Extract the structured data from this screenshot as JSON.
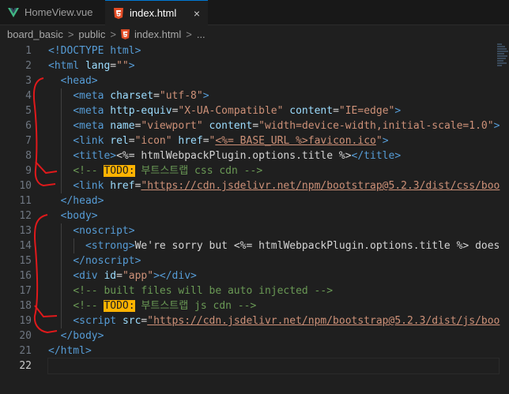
{
  "tabs": [
    {
      "label": "HomeView.vue",
      "icon": "vue-icon",
      "active": false
    },
    {
      "label": "index.html",
      "icon": "html5-icon",
      "active": true,
      "close": "×"
    }
  ],
  "breadcrumb": {
    "items": [
      "board_basic",
      "public",
      "index.html",
      "..."
    ],
    "separator": ">"
  },
  "editor": {
    "line_numbers": [
      "1",
      "2",
      "3",
      "4",
      "5",
      "6",
      "7",
      "8",
      "9",
      "10",
      "11",
      "12",
      "13",
      "14",
      "15",
      "16",
      "17",
      "18",
      "19",
      "20",
      "21",
      "22"
    ],
    "current_line": "22",
    "lines": {
      "l1": [
        "<!DOCTYPE ",
        "html",
        ">"
      ],
      "l2": [
        "<html ",
        "lang",
        "=",
        "\"\"",
        ">"
      ],
      "l3": [
        "<head",
        ">"
      ],
      "l4": [
        "<meta ",
        "charset",
        "=",
        "\"utf-8\"",
        ">"
      ],
      "l5": [
        "<meta ",
        "http-equiv",
        "=",
        "\"X-UA-Compatible\"",
        " content",
        "=",
        "\"IE=edge\"",
        ">"
      ],
      "l6": [
        "<meta ",
        "name",
        "=",
        "\"viewport\"",
        " content",
        "=",
        "\"width=device-width,initial-scale=1.0\"",
        ">"
      ],
      "l7": [
        "<link ",
        "rel",
        "=",
        "\"icon\"",
        " href",
        "=",
        "\"",
        "<%= BASE_URL %>",
        "favicon.ico",
        "\"",
        ">"
      ],
      "l8": [
        "<title>",
        "<%= htmlWebpackPlugin.options.title %>",
        "</title>"
      ],
      "l9": [
        "<!-- ",
        "TODO:",
        " 부트스트랩 css cdn -->"
      ],
      "l10": [
        "<link ",
        "href",
        "=",
        "\"https://cdn.jsdelivr.net/npm/bootstrap@5.2.3/dist/css/boo"
      ],
      "l11": [
        "</head>"
      ],
      "l12": [
        "<body>"
      ],
      "l13": [
        "<noscript>"
      ],
      "l14": [
        "<strong>",
        "We're sorry but ",
        "<%= htmlWebpackPlugin.options.title %>",
        " does"
      ],
      "l15": [
        "</noscript>"
      ],
      "l16": [
        "<div ",
        "id",
        "=",
        "\"app\"",
        "></div>"
      ],
      "l17": [
        "<!-- built files will be auto injected -->"
      ],
      "l18": [
        "<!-- ",
        "TODO:",
        " 부트스트랩 js cdn -->"
      ],
      "l19": [
        "<script ",
        "src",
        "=",
        "\"https://cdn.jsdelivr.net/npm/bootstrap@5.2.3/dist/js/boo"
      ],
      "l20": [
        "</body>"
      ],
      "l21": [
        "</html>"
      ]
    }
  },
  "colors": {
    "tag": "#569cd6",
    "attribute": "#9cdcfe",
    "string": "#ce9178",
    "comment": "#6a9955",
    "todo_highlight": "#ffb300",
    "annotation": "#e0191b",
    "tab_accent": "#0078d4"
  }
}
